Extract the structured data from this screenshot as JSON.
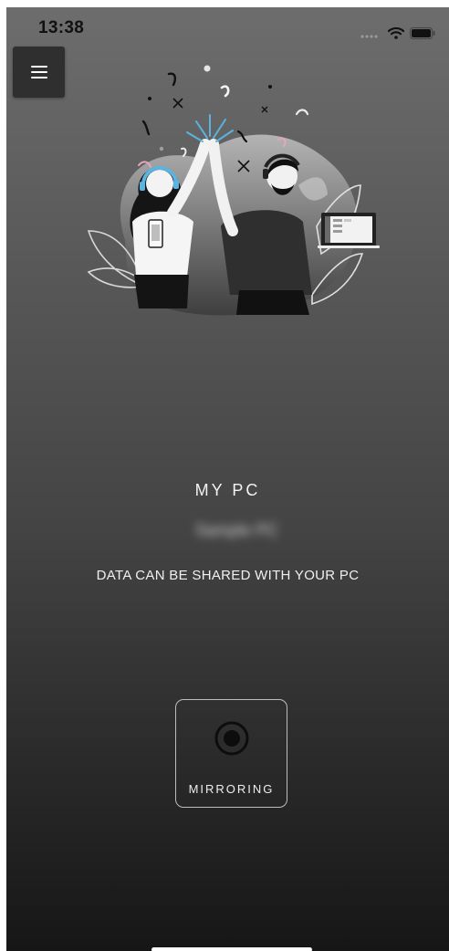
{
  "status_bar": {
    "time": "13:38",
    "icons": [
      "cellular-signal-icon",
      "wifi-icon",
      "battery-icon"
    ]
  },
  "menu": {
    "icon": "hamburger-menu-icon"
  },
  "illustration": {
    "icon": "high-five-illustration"
  },
  "pc": {
    "title": "MY PC",
    "name": "Sample PC",
    "status": "DATA CAN BE SHARED WITH YOUR PC"
  },
  "mirroring": {
    "label": "MIRRORING",
    "icon": "record-icon"
  },
  "colors": {
    "accent_blue": "#5ab4e0",
    "accent_pink": "#e7a5b8",
    "text": "#f2f2f2"
  }
}
